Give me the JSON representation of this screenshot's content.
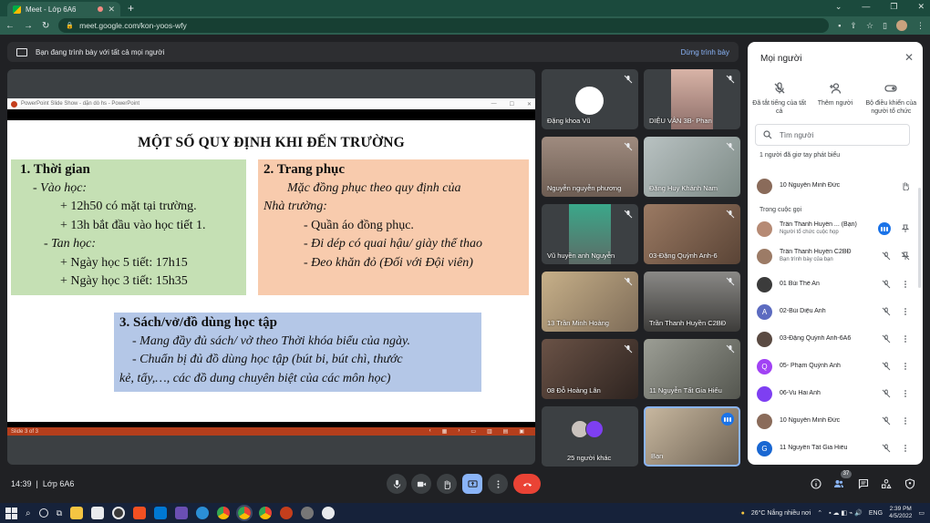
{
  "browser": {
    "tab_title": "Meet - Lớp 6A6",
    "tab_close": "✕",
    "new_tab": "+",
    "url": "meet.google.com/kon-yoos-wfy",
    "controls": [
      "⌄",
      "—",
      "❐",
      "✕"
    ]
  },
  "banner": {
    "text": "Bạn đang trình bày với tất cả mọi người",
    "stop_label": "Dừng trình bày"
  },
  "ppt": {
    "window_title": "PowerPoint Slide Show  -  dặn dò hs  -  PowerPoint",
    "status": "Slide 3 of 3",
    "slide": {
      "title": "MỘT SỐ QUY ĐỊNH KHI ĐẾN TRƯỜNG",
      "box1": {
        "heading": "1.   Thời gian",
        "lines": [
          "- Vào học:",
          "+ 12h50 có mặt tại trường.",
          "+ 13h bắt đầu vào học tiết 1.",
          "-   Tan học:",
          "+ Ngày học 5 tiết: 17h15",
          "+ Ngày học 3 tiết: 15h35"
        ]
      },
      "box2": {
        "heading": "2. Trang phục",
        "lines": [
          "Mặc đồng phục theo quy định của",
          "Nhà trường:",
          "- Quần áo đồng phục.",
          "- Đi dép có quai hậu/ giày thể thao",
          "- Đeo khăn đỏ (Đối với Đội viên)"
        ]
      },
      "box3": {
        "heading": "3.   Sách/vở/đồ dùng học tập",
        "lines": [
          "- Mang đầy đủ sách/ vở theo Thời khóa biểu của ngày.",
          "- Chuẩn bị đủ đồ dùng học tập (bút bi, bút chì, thước",
          "kẻ, tẩy,…, các đồ dung chuyên biệt của các môn học)"
        ]
      }
    }
  },
  "tiles": [
    {
      "name": "Đặng khoa Vũ",
      "bg": "#3c4043"
    },
    {
      "name": "DIỆU VÂN 3B- Phan",
      "bg": "#b18a7c"
    },
    {
      "name": "Nguyễn nguyễn phương",
      "bg": "#8d7a6e"
    },
    {
      "name": "Đặng Huy Khánh Nam",
      "bg": "#9aa6a8"
    },
    {
      "name": "Vũ huyền anh Nguyễn",
      "bg": "#6d7f7a"
    },
    {
      "name": "03-Đặng Quỳnh Anh-6",
      "bg": "#7b6354"
    },
    {
      "name": "13 Trần Minh Hoàng",
      "bg": "#a58f73"
    },
    {
      "name": "Trần Thanh Huyền C2BĐ",
      "bg": "#5b5a58"
    },
    {
      "name": "08 Đỗ Hoàng Lân",
      "bg": "#51413a"
    },
    {
      "name": "11 Nguyễn Tất Gia Hiếu",
      "bg": "#7a7c74"
    },
    {
      "name": "25 người khác",
      "bg": "#3c4043"
    },
    {
      "name": "Bạn",
      "bg": "#8a7d6b"
    }
  ],
  "panel": {
    "title": "Mọi người",
    "actions": [
      {
        "label": "Đã tắt tiếng của tất cả",
        "icon": "mic-off-icon"
      },
      {
        "label": "Thêm người",
        "icon": "add-person-icon"
      },
      {
        "label": "Bộ điều khiển của người tổ chức",
        "icon": "toggle-icon"
      }
    ],
    "search_placeholder": "Tìm người",
    "raised_label": "1 người đã giơ tay phát biểu",
    "raised": [
      {
        "name": "10 Nguyễn Minh Đức",
        "avatar": "#8a6b5a"
      }
    ],
    "in_call_label": "Trong cuộc gọi",
    "people": [
      {
        "name": "Trần Thanh Huyền ...  (Bạn)",
        "sub": "Người tổ chức cuộc họp",
        "avatar": "#b68a74",
        "letter": ""
      },
      {
        "name": "Trần Thanh Huyền C2BĐ",
        "sub": "Bạn trình bày của bạn",
        "avatar": "#9c7b66",
        "letter": ""
      },
      {
        "name": "01 Bùi Thế An",
        "sub": "",
        "avatar": "#3b3b3b",
        "letter": ""
      },
      {
        "name": "02-Bùi Diệu Anh",
        "sub": "",
        "avatar": "#5c6bc0",
        "letter": "A"
      },
      {
        "name": "03-Đặng Quỳnh Anh-6A6",
        "sub": "",
        "avatar": "#5a4a42",
        "letter": ""
      },
      {
        "name": "05- Phạm Quỳnh Anh",
        "sub": "",
        "avatar": "#a142f4",
        "letter": "Q"
      },
      {
        "name": "06-Vu Hai Anh",
        "sub": "",
        "avatar": "#7e3ff2",
        "letter": ""
      },
      {
        "name": "10 Nguyễn Minh Đức",
        "sub": "",
        "avatar": "#8a6b5a",
        "letter": ""
      },
      {
        "name": "11 Nguyễn Tất Gia Hiếu",
        "sub": "",
        "avatar": "#1967d2",
        "letter": "G"
      }
    ]
  },
  "bottom": {
    "time": "14:39",
    "separator": "|",
    "meeting": "Lớp 6A6",
    "people_count": "37"
  },
  "taskbar": {
    "weather": "26°C  Nắng nhiều nơi",
    "lang": "ENG",
    "time": "2:39 PM",
    "date": "4/5/2022"
  }
}
